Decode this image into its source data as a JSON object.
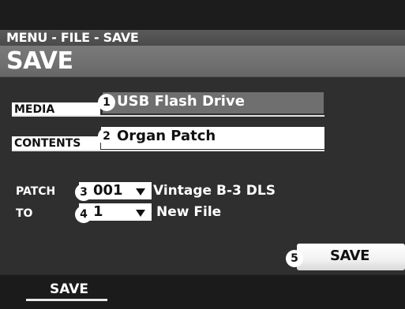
{
  "breadcrumb": "MENU - FILE - SAVE",
  "title": "SAVE",
  "fields": {
    "media": {
      "label": "MEDIA",
      "value": "USB Flash Drive",
      "badge": "1"
    },
    "contents": {
      "label": "CONTENTS",
      "value": "Organ Patch",
      "badge": "2"
    },
    "patch": {
      "label": "PATCH",
      "value": "001",
      "name": "Vintage B-3 DLS",
      "badge": "3"
    },
    "to": {
      "label": "TO",
      "value": "1",
      "name": "New File",
      "badge": "4"
    }
  },
  "save_button": {
    "label": "SAVE",
    "badge": "5"
  },
  "tabs": [
    {
      "label": "SAVE",
      "active": true
    }
  ],
  "icons": {
    "dropdown": "dropdown-arrow-icon"
  },
  "colors": {
    "background": "#2f2f2f",
    "title_bar": "#707070",
    "text": "#ffffff"
  }
}
